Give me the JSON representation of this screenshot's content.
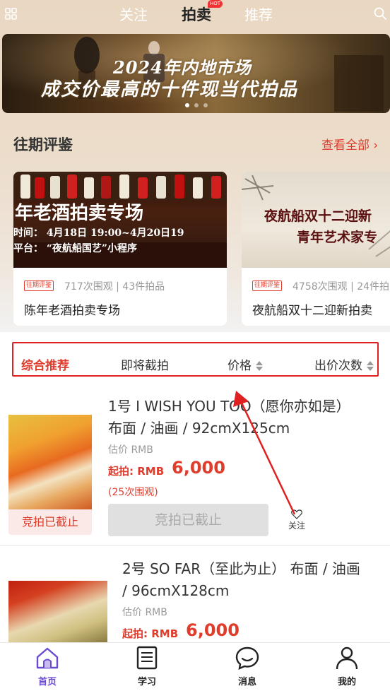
{
  "top_nav": {
    "tabs": [
      {
        "label": "关注"
      },
      {
        "label": "拍卖",
        "badge": "HOT"
      },
      {
        "label": "推荐"
      }
    ],
    "active_tab": "拍卖"
  },
  "banner": {
    "line1": "2024年内地市场",
    "line2": "成交价最高的十件现当代拍品",
    "dots": 3,
    "active_dot": 1
  },
  "past_reviews": {
    "title": "往期评鉴",
    "view_all": "查看全部",
    "cards": [
      {
        "img_title": "年老酒拍卖专场",
        "img_line1": "时间：  4月18日 19:00~4月20日19",
        "img_line2": "平台：  “夜航船国艺”小程序",
        "tag": "往期评鉴",
        "stats": "717次围观 | 43件拍品",
        "name": "陈年老酒拍卖专场"
      },
      {
        "img_title": "夜航船双十二迎新",
        "img_subtitle": "青年艺术家专",
        "tag": "往期评鉴",
        "stats": "4758次围观 | 24件拍",
        "name": "夜航船双十二迎新拍卖"
      }
    ]
  },
  "filters": [
    {
      "label": "综合推荐",
      "active": true
    },
    {
      "label": "即将截拍"
    },
    {
      "label": "价格",
      "sortable": true
    },
    {
      "label": "出价次数",
      "sortable": true
    }
  ],
  "listings": [
    {
      "title_line1": "1号 I WISH YOU TOO（愿你亦如是）",
      "title_line2": "布面 / 油画 / 92cmX125cm",
      "estimate": "估价 RMB",
      "start_label": "起拍: RMB",
      "start_price": "6,000",
      "views": "(25次围观)",
      "status_label": "竞拍已截止",
      "button": "竞拍已截止",
      "fav_label": "关注"
    },
    {
      "title_line1": "2号 SO FAR（至此为止） 布面 / 油画",
      "title_line2": "/ 96cmX128cm",
      "estimate": "估价 RMB",
      "start_label": "起拍: RMB",
      "start_price": "6,000"
    }
  ],
  "tab_bar": [
    {
      "label": "首页",
      "icon": "home-icon",
      "active": true
    },
    {
      "label": "学习",
      "icon": "book-icon"
    },
    {
      "label": "消息",
      "icon": "chat-icon"
    },
    {
      "label": "我的",
      "icon": "user-icon"
    }
  ],
  "colors": {
    "accent": "#e03c2c",
    "tab_active": "#6a4bd0",
    "annotation": "#e02020"
  }
}
